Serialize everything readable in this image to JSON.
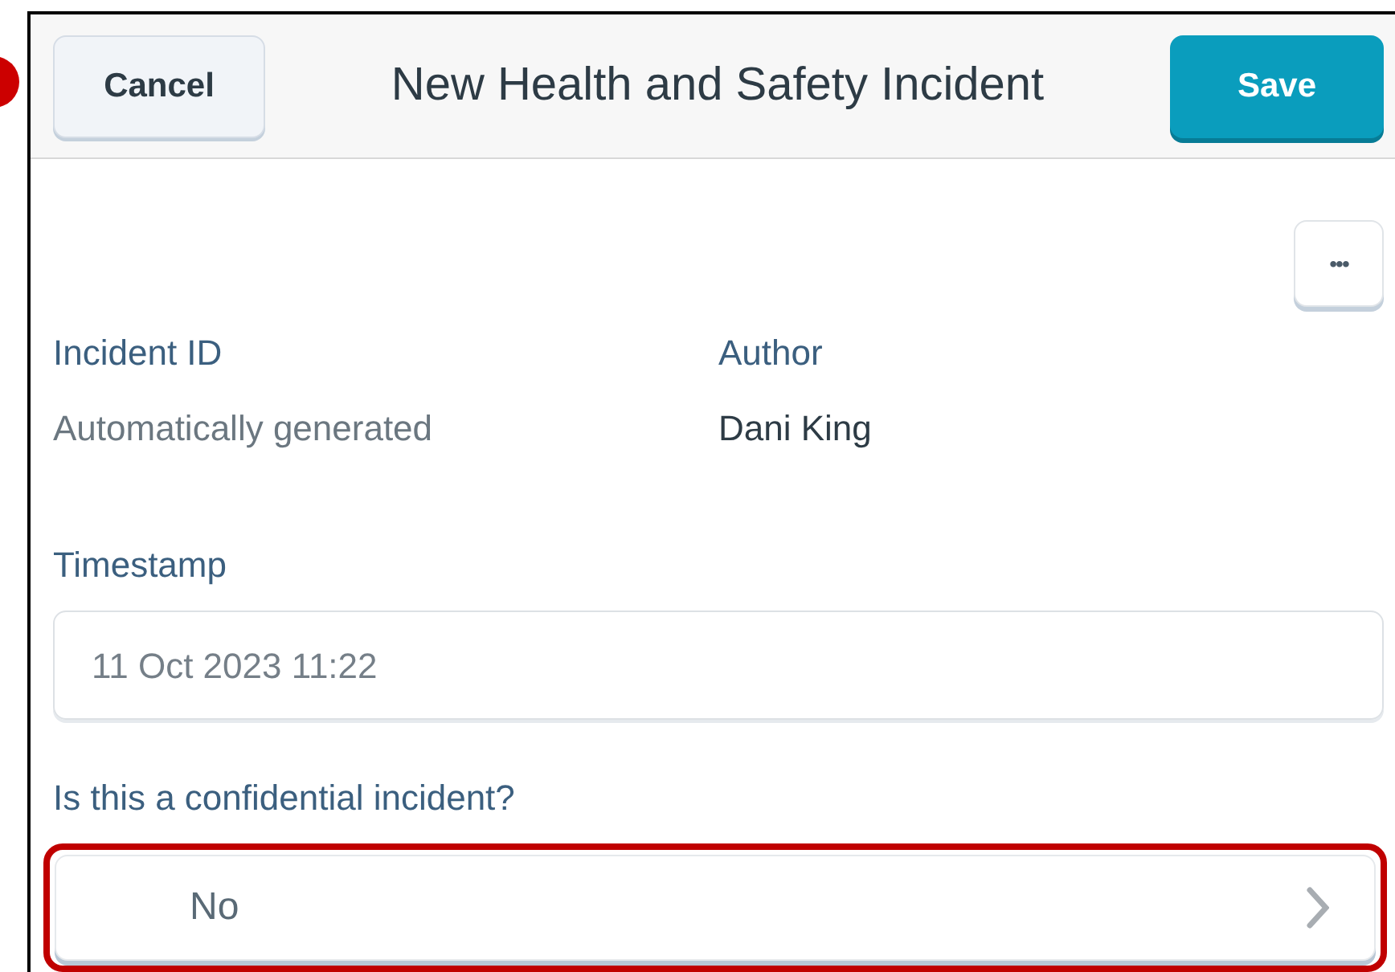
{
  "header": {
    "cancel_button": "Cancel",
    "title": "New Health and Safety Incident",
    "save_button": "Save"
  },
  "more_button": "•••",
  "info_fields": [
    {
      "label": "Incident ID",
      "value": "Automatically generated",
      "muted": true
    },
    {
      "label": "Author",
      "value": "Dani King",
      "muted": false
    }
  ],
  "timestamp": {
    "label": "Timestamp",
    "value": "11 Oct 2023 11:22"
  },
  "confidential": {
    "label": "Is this a confidential incident?",
    "value": "No",
    "highlighted": true
  }
}
